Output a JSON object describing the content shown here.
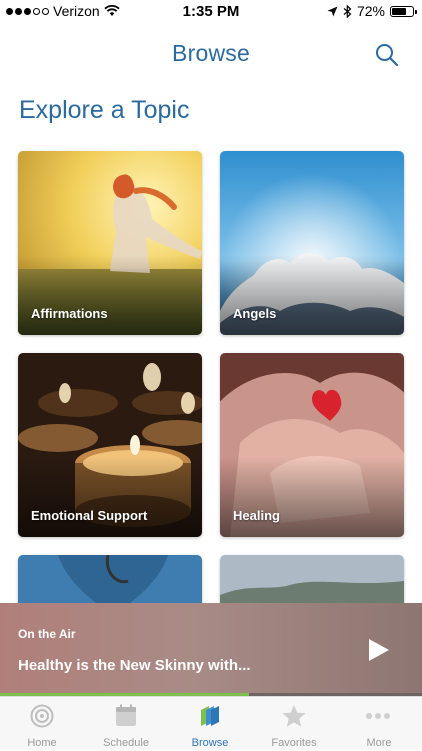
{
  "status_bar": {
    "carrier": "Verizon",
    "time": "1:35 PM",
    "battery": "72%",
    "battery_level": 0.72,
    "signal_bars_filled": 3,
    "signal_bars_total": 5
  },
  "nav": {
    "title": "Browse",
    "search_icon": "search-icon"
  },
  "section_title": "Explore a Topic",
  "topics": [
    {
      "label": "Affirmations"
    },
    {
      "label": "Angels"
    },
    {
      "label": "Emotional Support"
    },
    {
      "label": "Healing"
    }
  ],
  "on_air": {
    "kicker": "On the Air",
    "show_title": "Healthy is the New Skinny with...",
    "progress": 0.59,
    "play_icon": "play-icon"
  },
  "tabs": [
    {
      "label": "Home",
      "icon": "radio-icon",
      "active": false
    },
    {
      "label": "Schedule",
      "icon": "calendar-icon",
      "active": false
    },
    {
      "label": "Browse",
      "icon": "stack-icon",
      "active": true
    },
    {
      "label": "Favorites",
      "icon": "star-icon",
      "active": false
    },
    {
      "label": "More",
      "icon": "ellipsis-icon",
      "active": false
    }
  ],
  "colors": {
    "accent": "#2b6a9e",
    "tab_active": "#2e76b5",
    "tab_inactive": "#9a9a9a",
    "progress": "#7ec04e"
  }
}
